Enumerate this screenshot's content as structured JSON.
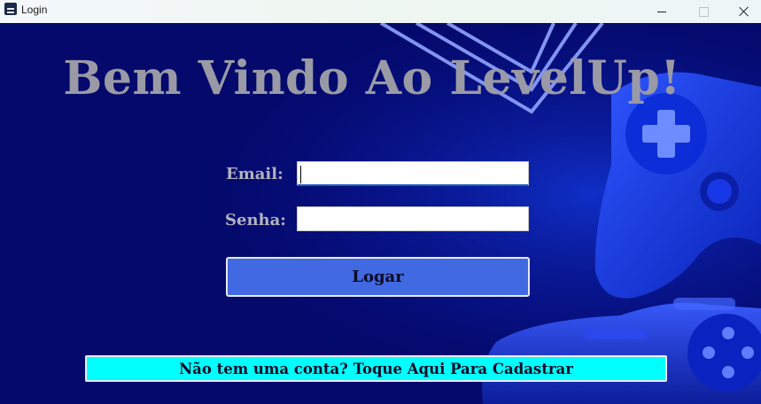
{
  "window": {
    "title": "Login",
    "icon": "app-window-icon",
    "controls": [
      "minimize-icon",
      "maximize-icon",
      "close-icon"
    ]
  },
  "main": {
    "headline": "Bem Vindo Ao LevelUp!",
    "email_label": "Email:",
    "email_value": "",
    "password_label": "Senha:",
    "password_value": "",
    "login_button": "Logar",
    "signup_link": "Não tem uma conta? Toque Aqui Para Cadastrar"
  },
  "colors": {
    "background": "#04096b",
    "accent_blue": "#4169e1",
    "signup_cyan": "#00ffff",
    "headline_gray": "#9a9aa6"
  }
}
